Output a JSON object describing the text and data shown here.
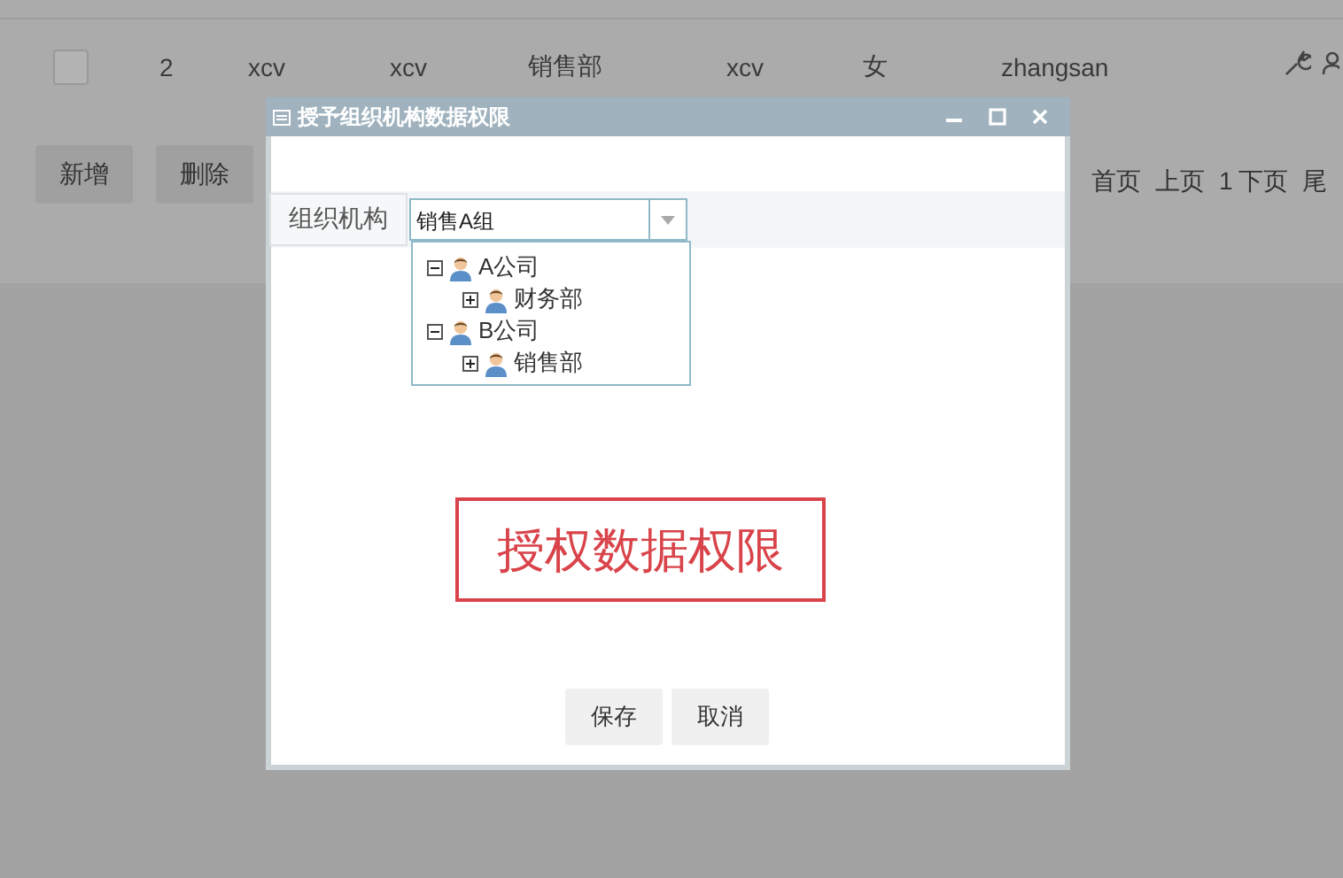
{
  "table": {
    "rows": [
      {
        "checked": false,
        "cells": [
          "2",
          "xcv",
          "xcv",
          "销售部",
          "xcv",
          "女",
          "zhangsan"
        ]
      }
    ]
  },
  "buttons": [
    "新增",
    "删除"
  ],
  "pager": [
    "首页",
    "上页",
    "1",
    "下页",
    "尾"
  ],
  "dialog": {
    "title": "授予组织机构数据权限",
    "filter": {
      "label": "组织机构",
      "value": "销售A组"
    },
    "tree": [
      {
        "label": "A公司",
        "expanded": true,
        "children": [
          {
            "label": "财务部",
            "expanded": false
          }
        ]
      },
      {
        "label": "B公司",
        "expanded": true,
        "children": [
          {
            "label": "销售部",
            "expanded": false
          }
        ]
      }
    ],
    "note": "授权数据权限",
    "buttons": [
      "保存",
      "取消"
    ]
  }
}
